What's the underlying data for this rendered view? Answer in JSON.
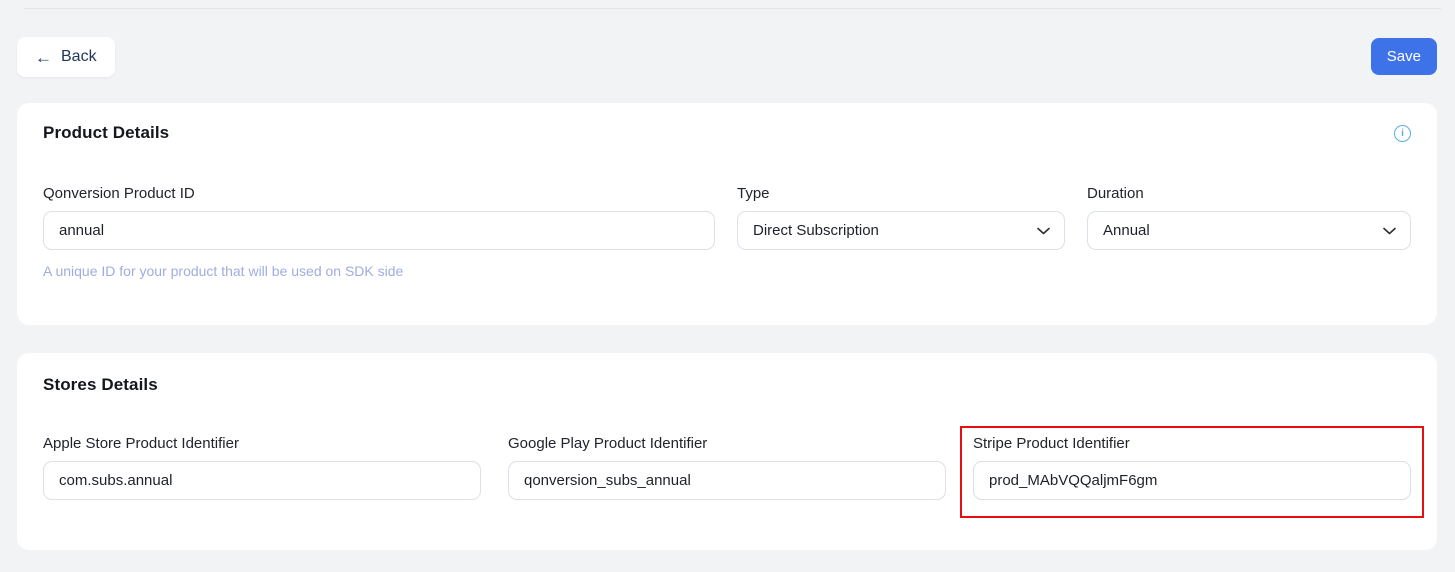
{
  "toolbar": {
    "back_arrow": "←",
    "back_label": "Back",
    "save_label": "Save"
  },
  "product_details": {
    "title": "Product Details",
    "info_icon_glyph": "i",
    "fields": {
      "product_id": {
        "label": "Qonversion Product ID",
        "value": "annual",
        "helper": "A unique ID for your product that will be used on SDK side"
      },
      "type": {
        "label": "Type",
        "value": "Direct Subscription"
      },
      "duration": {
        "label": "Duration",
        "value": "Annual"
      }
    }
  },
  "stores_details": {
    "title": "Stores Details",
    "fields": {
      "apple": {
        "label": "Apple Store Product Identifier",
        "value": "com.subs.annual"
      },
      "google": {
        "label": "Google Play Product Identifier",
        "value": "qonversion_subs_annual"
      },
      "stripe": {
        "label": "Stripe Product Identifier",
        "value": "prod_MAbVQQaljmF6gm"
      }
    }
  },
  "colors": {
    "page_background": "#f2f3f5",
    "accent_blue": "#3e72e8",
    "highlight_red": "#e50f0f",
    "helper_text": "#9fade0",
    "info_icon": "#5aade0",
    "input_border": "#dbe0ea"
  }
}
